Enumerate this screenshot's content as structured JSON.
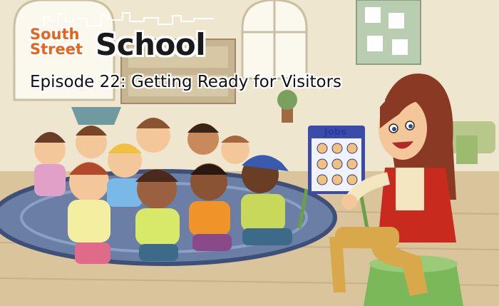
{
  "logo": {
    "line1": "South",
    "line2": "Street",
    "word": "School"
  },
  "episode_title": "Episode 22: Getting Ready for Visitors",
  "board": {
    "title": "Jobs"
  },
  "colors": {
    "logo_orange": "#e8641c",
    "teacher_hair": "#8a3a24",
    "teacher_vest": "#c82a1e",
    "board_blue": "#2a3aa0"
  }
}
